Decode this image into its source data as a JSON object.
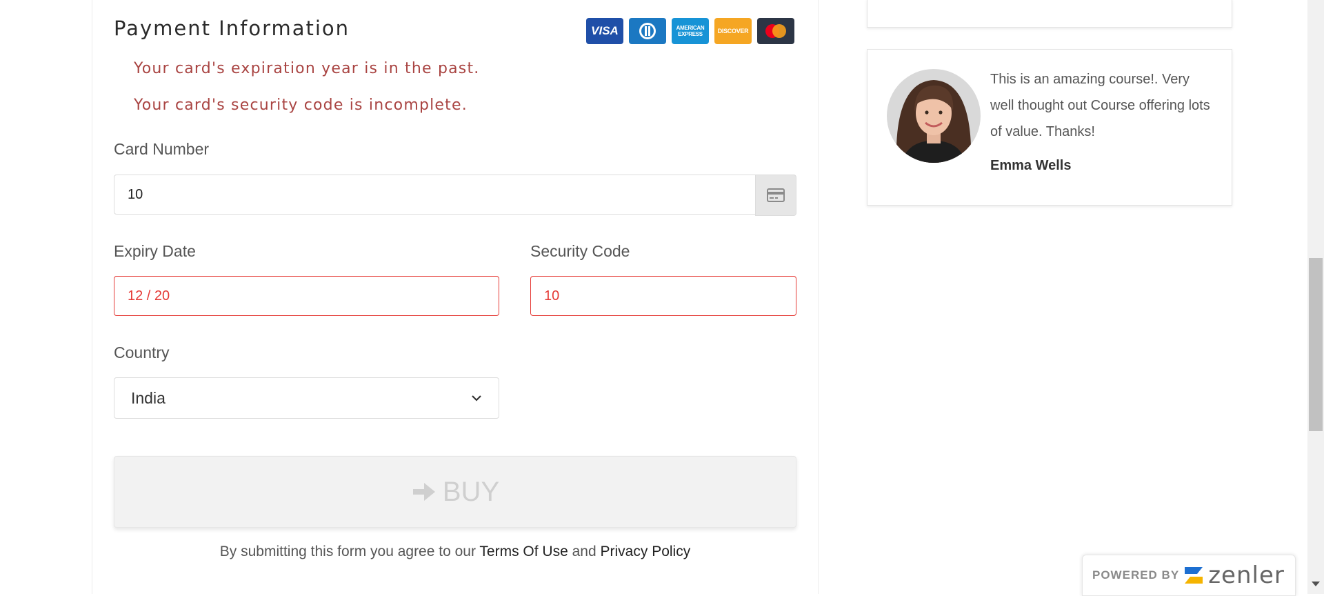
{
  "payment": {
    "title": "Payment Information",
    "card_logos": [
      {
        "name": "visa",
        "label": "VISA",
        "color": "#1f4fa8"
      },
      {
        "name": "diners",
        "label": "",
        "color": "#1b78c2"
      },
      {
        "name": "amex",
        "label": "AMERICAN EXPRESS",
        "color": "#1793d6"
      },
      {
        "name": "discover",
        "label": "DISCOVER",
        "color": "#f5a623"
      },
      {
        "name": "mastercard",
        "label": "",
        "color": "#2c3545"
      }
    ],
    "errors": [
      "Your card's expiration year is in the past.",
      "Your card's security code is incomplete."
    ],
    "card_number": {
      "label": "Card Number",
      "value": "10",
      "addon_icon": "credit-card-icon"
    },
    "expiry": {
      "label": "Expiry Date",
      "value": "12 / 20"
    },
    "security_code": {
      "label": "Security Code",
      "value": "10"
    },
    "country": {
      "label": "Country",
      "value": "India"
    },
    "buy_button": {
      "label": "BUY",
      "icon": "arrow-right-icon"
    },
    "terms": {
      "prefix": "By submitting this form you agree to our",
      "terms_link": "Terms Of Use",
      "conjunction": "and",
      "privacy_link": "Privacy Policy"
    }
  },
  "testimonial": {
    "quote": "This is an amazing course!. Very well thought out Course offering lots of value. Thanks!",
    "author": "Emma Wells"
  },
  "powered_by": {
    "text": "POWERED BY",
    "brand": "zenler"
  },
  "colors": {
    "error": "#a94442",
    "invalid_border": "#e53935",
    "button_disabled_bg": "#f2f2f2"
  }
}
